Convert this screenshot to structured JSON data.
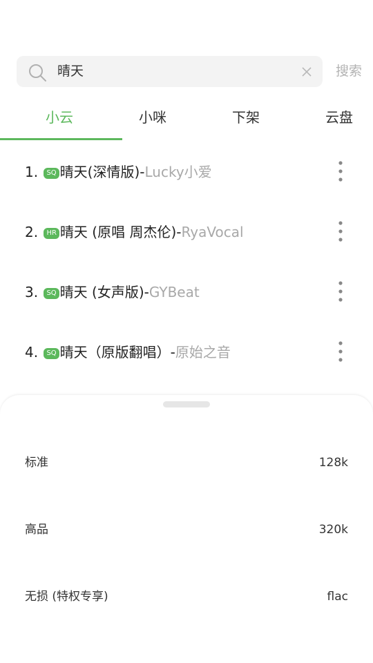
{
  "search": {
    "query": "晴天",
    "button_label": "搜索"
  },
  "tabs": [
    {
      "label": "小云",
      "active": true
    },
    {
      "label": "小咪",
      "active": false
    },
    {
      "label": "下架",
      "active": false
    },
    {
      "label": "云盘",
      "active": false
    }
  ],
  "songs": [
    {
      "index": "1.",
      "badge": "SQ",
      "title": "晴天(深情版)-",
      "artist": "Lucky小爱"
    },
    {
      "index": "2.",
      "badge": "HR",
      "title": "晴天 (原唱 周杰伦)-",
      "artist": "RyaVocal"
    },
    {
      "index": "3.",
      "badge": "SQ",
      "title": "晴天 (女声版)-",
      "artist": "GYBeat"
    },
    {
      "index": "4.",
      "badge": "SQ",
      "title": "晴天（原版翻唱）-",
      "artist": "原始之音"
    }
  ],
  "quality_sheet": {
    "options": [
      {
        "label": "标准",
        "value": "128k"
      },
      {
        "label": "高品",
        "value": "320k"
      },
      {
        "label": "无损 (特权专享)",
        "value": "flac"
      }
    ]
  },
  "colors": {
    "accent": "#5cb85c",
    "muted_text": "#a8a8a8",
    "search_bg": "#f3f3f3"
  }
}
